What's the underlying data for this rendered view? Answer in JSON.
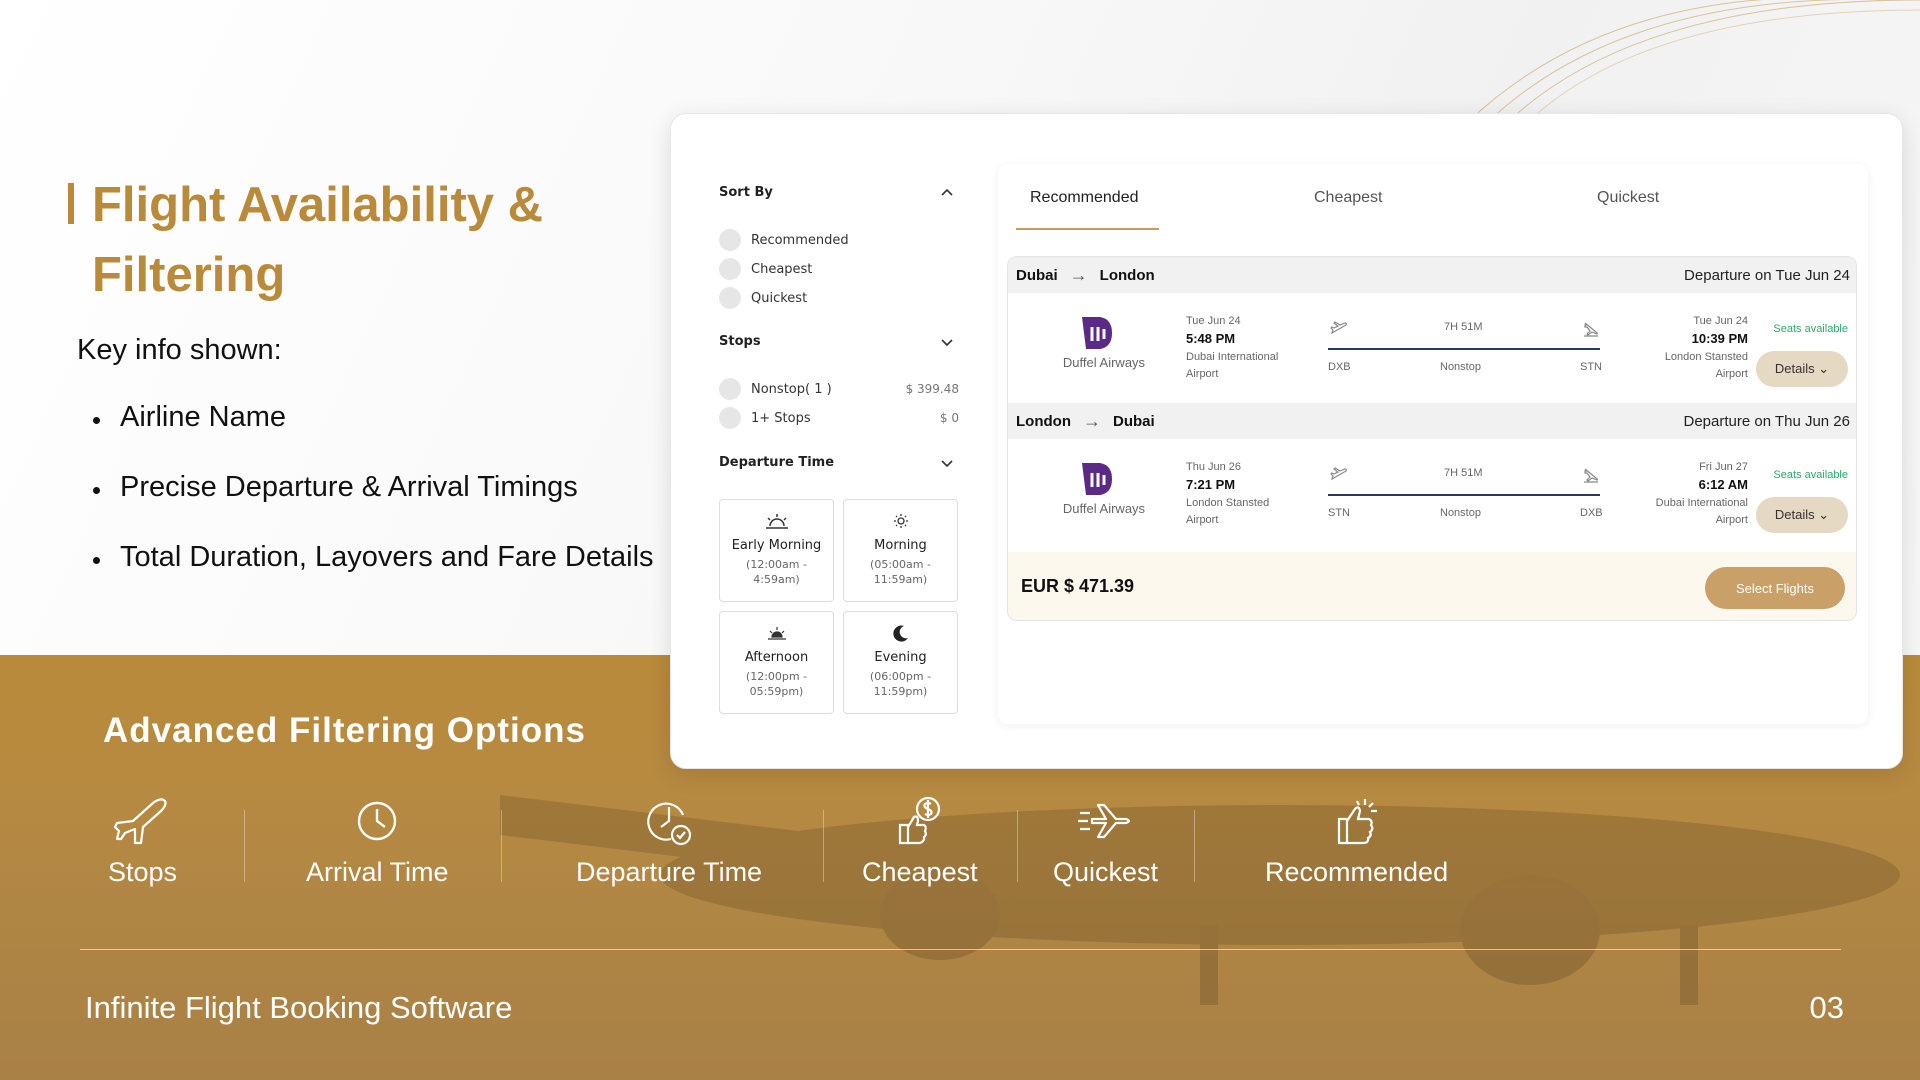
{
  "slide": {
    "title_line1": "Flight Availability &",
    "title_line2": "Filtering",
    "key_info_heading": "Key info shown:",
    "bullets": [
      "Airline Name",
      "Precise Departure & Arrival Timings",
      "Total Duration, Layovers and Fare Details"
    ],
    "advanced_title": "Advanced Filtering Options",
    "features": [
      {
        "label": "Stops",
        "icon": "airplane-icon"
      },
      {
        "label": "Arrival Time",
        "icon": "clock-icon"
      },
      {
        "label": "Departure Time",
        "icon": "clock-check-icon"
      },
      {
        "label": "Cheapest",
        "icon": "dollar-thumb-icon"
      },
      {
        "label": "Quickest",
        "icon": "fast-plane-icon"
      },
      {
        "label": "Recommended",
        "icon": "thumbs-up-icon"
      }
    ],
    "footer_left": "Infinite Flight Booking Software",
    "footer_right": "03"
  },
  "filters": {
    "sort_by": "Sort By",
    "sort_options": [
      "Recommended",
      "Cheapest",
      "Quickest"
    ],
    "stops": "Stops",
    "stop_options": [
      {
        "label": "Nonstop( 1 )",
        "price": "$ 399.48"
      },
      {
        "label": "1+ Stops",
        "price": "$ 0"
      }
    ],
    "departure_time": "Departure Time",
    "time_slots": [
      {
        "name": "Early Morning",
        "range1": "(12:00am -",
        "range2": "4:59am)",
        "icon": "sunrise-icon"
      },
      {
        "name": "Morning",
        "range1": "(05:00am -",
        "range2": "11:59am)",
        "icon": "sun-icon"
      },
      {
        "name": "Afternoon",
        "range1": "(12:00pm -",
        "range2": "05:59pm)",
        "icon": "sunset-icon"
      },
      {
        "name": "Evening",
        "range1": "(06:00pm -",
        "range2": "11:59pm)",
        "icon": "moon-icon"
      }
    ]
  },
  "results": {
    "tabs": [
      "Recommended",
      "Cheapest",
      "Quickest"
    ],
    "legs": [
      {
        "from": "Dubai",
        "to": "London",
        "departure": "Departure on Tue Jun 24",
        "airline": "Duffel Airways",
        "dep_date": "Tue Jun 24",
        "dep_time": "5:48 PM",
        "dep_airport1": "Dubai International",
        "dep_airport2": "Airport",
        "dep_code": "DXB",
        "duration": "7H 51M",
        "stops": "Nonstop",
        "arr_code": "STN",
        "arr_date": "Tue Jun 24",
        "arr_time": "10:39 PM",
        "arr_airport1": "London Stansted",
        "arr_airport2": "Airport",
        "seats": "Seats available",
        "details": "Details"
      },
      {
        "from": "London",
        "to": "Dubai",
        "departure": "Departure on Thu Jun 26",
        "airline": "Duffel Airways",
        "dep_date": "Thu Jun 26",
        "dep_time": "7:21 PM",
        "dep_airport1": "London Stansted",
        "dep_airport2": "Airport",
        "dep_code": "STN",
        "duration": "7H 51M",
        "stops": "Nonstop",
        "arr_code": "DXB",
        "arr_date": "Fri Jun 27",
        "arr_time": "6:12 AM",
        "arr_airport1": "Dubai International",
        "arr_airport2": "Airport",
        "seats": "Seats available",
        "details": "Details"
      }
    ],
    "fare": "EUR $ 471.39",
    "select_button": "Select Flights"
  },
  "colors": {
    "gold": "#b98a3a",
    "navy": "#1f3b66",
    "airline_purple": "#5b2a86",
    "seats_green": "#2aaa6a"
  }
}
